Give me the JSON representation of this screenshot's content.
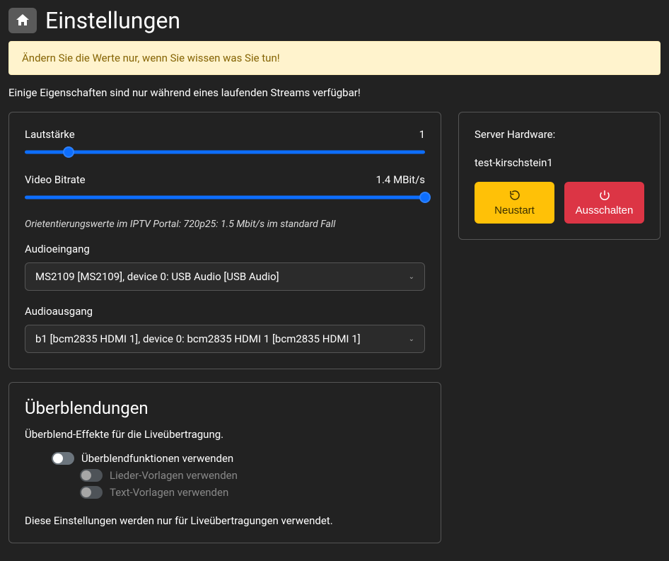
{
  "header": {
    "title": "Einstellungen"
  },
  "warning": "Ändern Sie die Werte nur, wenn Sie wissen was Sie tun!",
  "subtitle": "Einige Eigenschaften sind nur während eines laufenden Streams verfügbar!",
  "volume": {
    "label": "Lautstärke",
    "value": "1",
    "thumb_pct": 11
  },
  "bitrate": {
    "label": "Video Bitrate",
    "value": "1.4 MBit/s",
    "thumb_pct": 100
  },
  "bitrate_hint": "Orietentierungswerte im IPTV Portal: 720p25: 1.5 Mbit/s im standard Fall",
  "audio_in": {
    "label": "Audioeingang",
    "value": "MS2109 [MS2109], device 0: USB Audio [USB Audio]"
  },
  "audio_out": {
    "label": "Audioausgang",
    "value": "b1 [bcm2835 HDMI 1], device 0: bcm2835 HDMI 1 [bcm2835 HDMI 1]"
  },
  "overlays": {
    "title": "Überblendungen",
    "desc": "Überblend-Effekte für die Liveübertragung.",
    "use_overlays": "Überblendfunktionen verwenden",
    "use_song_templates": "Lieder-Vorlagen verwenden",
    "use_text_templates": "Text-Vorlagen verwenden",
    "note": "Diese Einstellungen werden nur für Liveübertragungen verwendet."
  },
  "hardware": {
    "label": "Server Hardware:",
    "name": "test-kirschstein1",
    "restart": "Neustart",
    "shutdown": "Ausschalten"
  }
}
